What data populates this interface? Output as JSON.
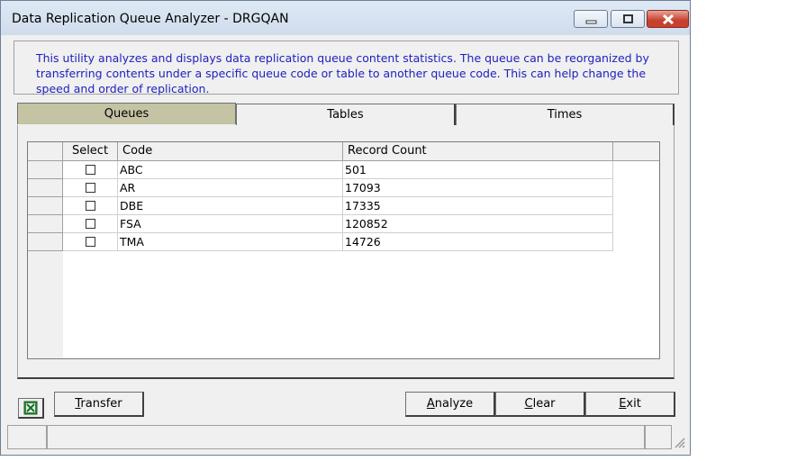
{
  "window": {
    "title": "Data Replication Queue Analyzer - DRGQAN",
    "controls": [
      "minimize-icon",
      "maximize-icon",
      "close-icon"
    ]
  },
  "info_text": "This utility analyzes and displays data replication queue content statistics. The queue can be reorganized by transferring contents under a specific queue code or table to another queue code. This can help change the speed and order of replication.",
  "tabs": [
    {
      "label": "Queues",
      "active": true
    },
    {
      "label": "Tables",
      "active": false
    },
    {
      "label": "Times",
      "active": false
    }
  ],
  "grid": {
    "headers": {
      "select": "Select",
      "code": "Code",
      "count": "Record Count"
    },
    "rows": [
      {
        "selected": false,
        "code": "ABC",
        "count": "501"
      },
      {
        "selected": false,
        "code": "AR",
        "count": "17093"
      },
      {
        "selected": false,
        "code": "DBE",
        "count": "17335"
      },
      {
        "selected": false,
        "code": "FSA",
        "count": "120852"
      },
      {
        "selected": false,
        "code": "TMA",
        "count": "14726"
      }
    ]
  },
  "buttons": {
    "excel_icon": "excel-icon",
    "transfer": {
      "first": "T",
      "rest": "ransfer"
    },
    "analyze": {
      "first": "A",
      "rest": "nalyze"
    },
    "clear": {
      "first": "C",
      "rest": "lear"
    },
    "exit": {
      "first": "E",
      "rest": "xit"
    }
  },
  "colors": {
    "info_text": "#2020c0",
    "active_tab": "#c4c3a3",
    "close_button": "#c6402d"
  }
}
